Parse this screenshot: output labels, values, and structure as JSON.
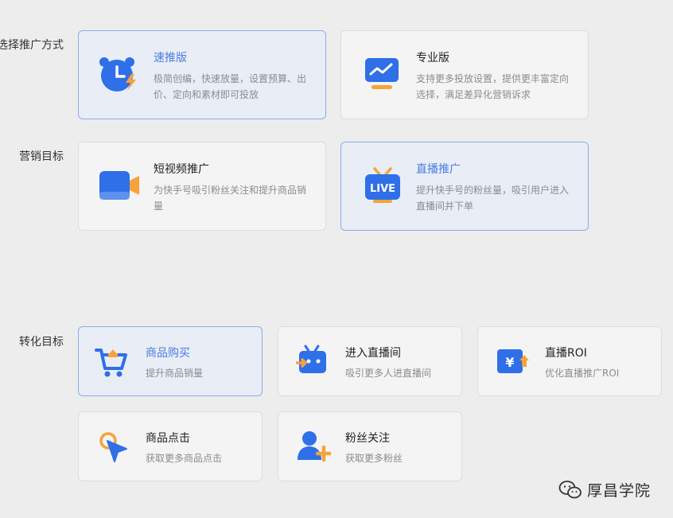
{
  "sections": {
    "method_label": "选择推广方式",
    "marketing_label": "营销目标",
    "conversion_label": "转化目标"
  },
  "method_cards": [
    {
      "title": "速推版",
      "desc": "极简创编，快速放量，设置预算、出价、定向和素材即可投放",
      "icon": "alarm-clock-lightning-icon",
      "selected": true
    },
    {
      "title": "专业版",
      "desc": "支持更多投放设置，提供更丰富定向选择，满足差异化营销诉求",
      "icon": "monitor-chart-icon",
      "selected": false
    }
  ],
  "marketing_cards": [
    {
      "title": "短视频推广",
      "desc": "为快手号吸引粉丝关注和提升商品销量",
      "icon": "video-camera-icon",
      "selected": false
    },
    {
      "title": "直播推广",
      "desc": "提升快手号的粉丝量，吸引用户进入直播间并下单",
      "icon": "live-tv-icon",
      "selected": true
    }
  ],
  "conversion_cards": [
    {
      "title": "商品购买",
      "desc": "提升商品销量",
      "icon": "shopping-cart-icon",
      "selected": true
    },
    {
      "title": "进入直播间",
      "desc": "吸引更多人进直播间",
      "icon": "enter-live-room-icon",
      "selected": false
    },
    {
      "title": "直播ROI",
      "desc": "优化直播推广ROI",
      "icon": "yuan-roi-icon",
      "selected": false
    },
    {
      "title": "商品点击",
      "desc": "获取更多商品点击",
      "icon": "click-cursor-icon",
      "selected": false
    },
    {
      "title": "粉丝关注",
      "desc": "获取更多粉丝",
      "icon": "add-follower-icon",
      "selected": false
    }
  ],
  "watermark": {
    "text": "厚昌学院",
    "icon": "wechat-logo-icon"
  },
  "colors": {
    "accent": "#4a7de0",
    "icon_blue": "#2f6fe8",
    "icon_orange": "#f5a33a",
    "selected_bg": "#e8edf6"
  }
}
